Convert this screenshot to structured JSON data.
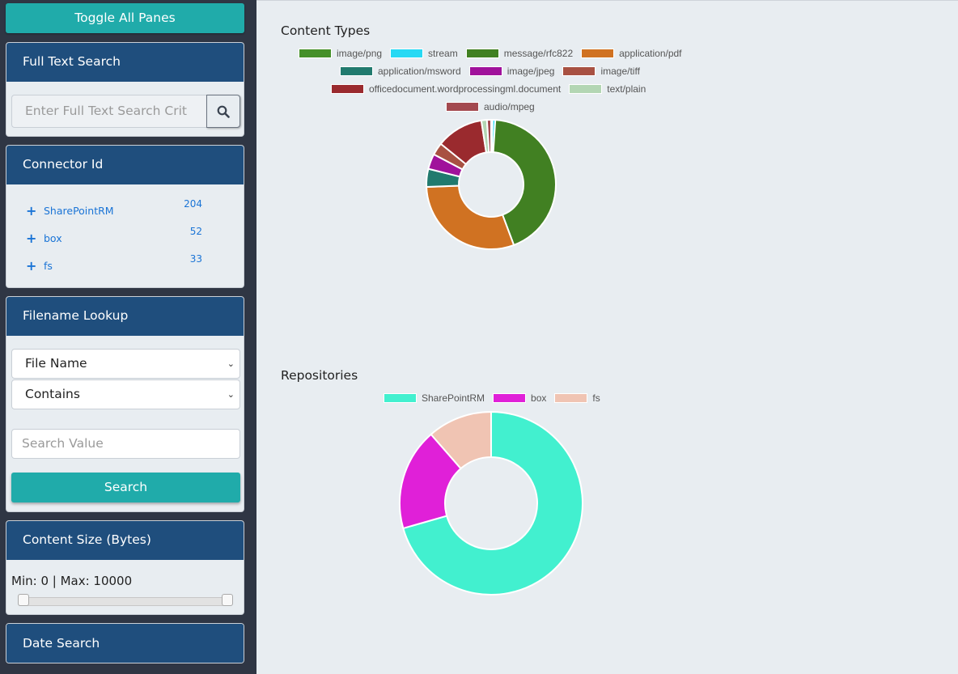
{
  "sidebar": {
    "toggle_label": "Toggle All Panes",
    "full_text_search": {
      "title": "Full Text Search",
      "placeholder": "Enter Full Text Search Crit",
      "button_icon": "search-icon"
    },
    "connector_id": {
      "title": "Connector Id",
      "items": [
        {
          "icon": "+",
          "name": "SharePointRM",
          "count": "204"
        },
        {
          "icon": "+",
          "name": "box",
          "count": "52"
        },
        {
          "icon": "+",
          "name": "fs",
          "count": "33"
        }
      ]
    },
    "filename_lookup": {
      "title": "Filename Lookup",
      "field_select": "File Name",
      "operator_select": "Contains",
      "search_placeholder": "Search Value",
      "search_label": "Search"
    },
    "content_size": {
      "title": "Content Size (Bytes)",
      "range_text": "Min: 0 | Max: 10000",
      "min": 0,
      "max": 10000
    },
    "date_search": {
      "title": "Date Search"
    }
  },
  "colors": {
    "sidebar_bg": "#2f3644",
    "panel_header": "#1f4e7d",
    "accent_teal": "#20abaa",
    "link_blue": "#1a74d6"
  },
  "chart_data": [
    {
      "type": "pie",
      "variant": "doughnut",
      "title": "Content Types",
      "legend_position": "top",
      "categories": [
        "image/png",
        "stream",
        "message/rfc822",
        "application/pdf",
        "application/msword",
        "image/jpeg",
        "image/tiff",
        "officedocument.wordprocessingml.document",
        "text/plain",
        "audio/mpeg"
      ],
      "values": [
        1,
        2,
        125,
        87,
        13,
        11,
        9,
        34,
        4,
        3
      ],
      "colors": [
        "#45902a",
        "#27d9f4",
        "#418022",
        "#d07222",
        "#217a6e",
        "#a0129b",
        "#a85142",
        "#9a2a2e",
        "#b3d6b3",
        "#a3494f"
      ]
    },
    {
      "type": "pie",
      "variant": "doughnut",
      "title": "Repositories",
      "legend_position": "top",
      "categories": [
        "SharePointRM",
        "box",
        "fs"
      ],
      "values": [
        204,
        52,
        33
      ],
      "colors": [
        "#42f0cf",
        "#e020d8",
        "#f0c4b3"
      ]
    }
  ]
}
